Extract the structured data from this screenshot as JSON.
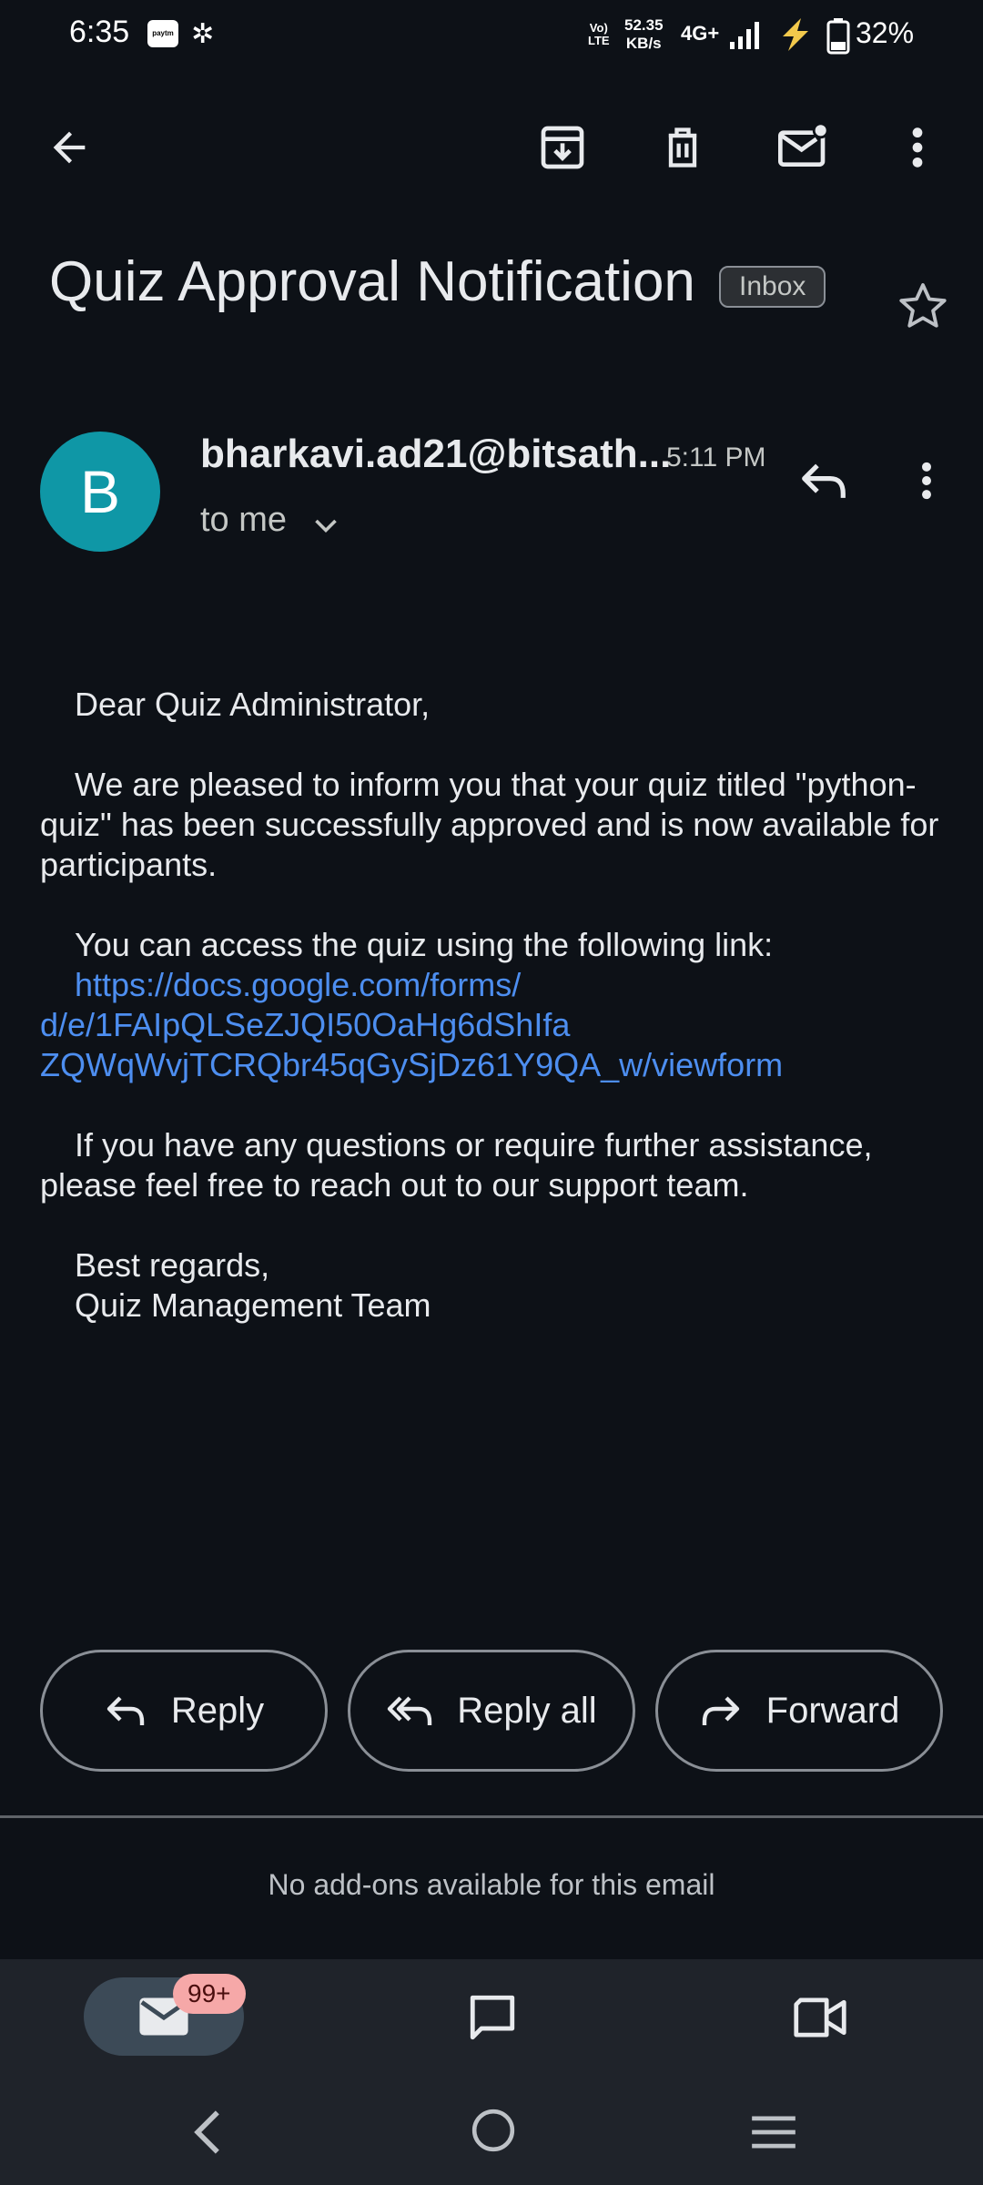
{
  "status_bar": {
    "time": "6:35",
    "paytm": "Paytm",
    "volte": "Vo\nLTE",
    "speed_value": "52.35",
    "speed_unit": "KB/s",
    "network": "4G+",
    "battery": "32%"
  },
  "toolbar": {
    "back_icon": "arrow-back-icon",
    "archive_icon": "archive-icon",
    "delete_icon": "delete-icon",
    "mark_unread_icon": "mail-unread-icon",
    "more_icon": "more-vert-icon"
  },
  "email": {
    "subject": "Quiz Approval Notification",
    "label": "Inbox",
    "sender_initial": "B",
    "sender": "bharkavi.ad21@bitsath...",
    "time": "5:11 PM",
    "recipient": "to me",
    "body": {
      "greeting": "Dear Quiz Administrator,",
      "para1": "We are pleased to inform you that your quiz titled \"python-quiz\" has been successfully approved and is now available for participants.",
      "para2": "You can access the quiz using the following link:",
      "link": "https://docs.google.com/forms/d/e/1FAIpQLSeZJQI50OaHg6dShIfaZQWqWvjTCRQbr45qGySjDz61Y9QA_w/viewform",
      "link_line1": "https://docs.google.com/forms/",
      "link_line2": "d/e/1FAIpQLSeZJQI50OaHg6dShIfa",
      "link_line3": "ZQWqWvjTCRQbr45qGySjDz61Y9QA_w/viewform",
      "para3": "If you have any questions or require further assistance, please feel free to reach out to our support team.",
      "closing": "Best regards,",
      "signature": "Quiz Management Team"
    }
  },
  "actions": {
    "reply": "Reply",
    "reply_all": "Reply all",
    "forward": "Forward"
  },
  "addons_text": "No add-ons available for this email",
  "bottom_nav": {
    "mail_badge": "99+"
  },
  "colors": {
    "background": "#0d1117",
    "avatar": "#0f97a6",
    "link": "#4d8ef0",
    "badge": "#f6a8a8"
  }
}
